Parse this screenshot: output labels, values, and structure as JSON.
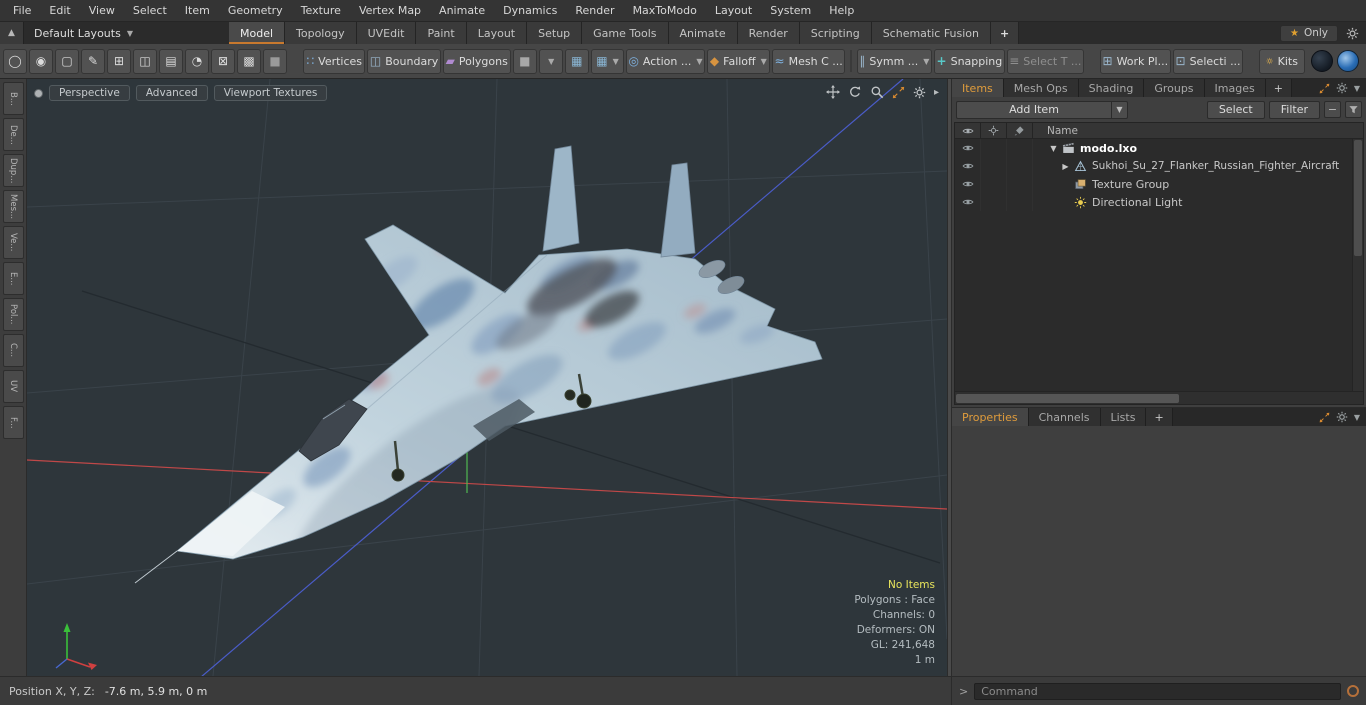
{
  "menubar": {
    "items": [
      "File",
      "Edit",
      "View",
      "Select",
      "Item",
      "Geometry",
      "Texture",
      "Vertex Map",
      "Animate",
      "Dynamics",
      "Render",
      "MaxToModo",
      "Layout",
      "System",
      "Help"
    ]
  },
  "layout_bar": {
    "preset": "Default Layouts",
    "tabs": [
      "Model",
      "Topology",
      "UVEdit",
      "Paint",
      "Layout",
      "Setup",
      "Game Tools",
      "Animate",
      "Render",
      "Scripting",
      "Schematic Fusion"
    ],
    "selected_tab": "Model",
    "add_tab": "+",
    "only": "Only"
  },
  "toolbar": {
    "labeled_buttons": [
      "Vertices",
      "Boundary",
      "Polygons",
      "Action ...",
      "Falloff",
      "Mesh C ...",
      "Symm ...",
      "Snapping",
      "Select T ...",
      "Work Pl...",
      "Selecti ...",
      "Kits"
    ],
    "tool_icons": [
      "ellipse-tool-icon",
      "sphere-tool-icon",
      "cube-tool-icon",
      "pen-tool-icon",
      "grid-tool-icon",
      "mirror-tool-icon",
      "plane-tool-icon",
      "radial-tool-icon",
      "slice-tool-icon",
      "pattern-tool-icon",
      "item-cube-icon"
    ]
  },
  "left_tabs": [
    "B...",
    "De...",
    "Dup...",
    "Mes...",
    "Ve...",
    "E...",
    "Pol...",
    "C...",
    "UV",
    "F..."
  ],
  "viewport": {
    "buttons": [
      "Perspective",
      "Advanced",
      "Viewport Textures"
    ],
    "info": {
      "highlight": "No Items",
      "lines": [
        "Polygons : Face",
        "Channels: 0",
        "Deformers: ON",
        "GL: 241,648",
        "1 m"
      ]
    }
  },
  "status_bar": {
    "label": "Position X, Y, Z:",
    "value": "-7.6 m, 5.9 m, 0 m"
  },
  "items_panel": {
    "tabs": [
      "Items",
      "Mesh Ops",
      "Shading",
      "Groups",
      "Images"
    ],
    "selected_tab": "Items",
    "add_tab": "+",
    "add_item": "Add Item",
    "select": "Select",
    "filter": "Filter",
    "name_header": "Name",
    "rows": [
      {
        "label": "modo.lxo",
        "icon": "scene-icon"
      },
      {
        "label": "Sukhoi_Su_27_Flanker_Russian_Fighter_Aircraft",
        "icon": "mesh-icon"
      },
      {
        "label": "Texture Group",
        "icon": "texture-group-icon"
      },
      {
        "label": "Directional Light",
        "icon": "directional-light-icon"
      }
    ]
  },
  "properties_panel": {
    "tabs": [
      "Properties",
      "Channels",
      "Lists"
    ],
    "selected_tab": "Properties",
    "add_tab": "+"
  },
  "command_bar": {
    "prompt": ">",
    "placeholder": "Command"
  },
  "colors": {
    "accent_orange": "#e09c3c",
    "axis_red": "#c04848",
    "axis_blue": "#4a5cc8",
    "axis_green": "#50b850",
    "highlight_yellow": "#e8e45c"
  }
}
